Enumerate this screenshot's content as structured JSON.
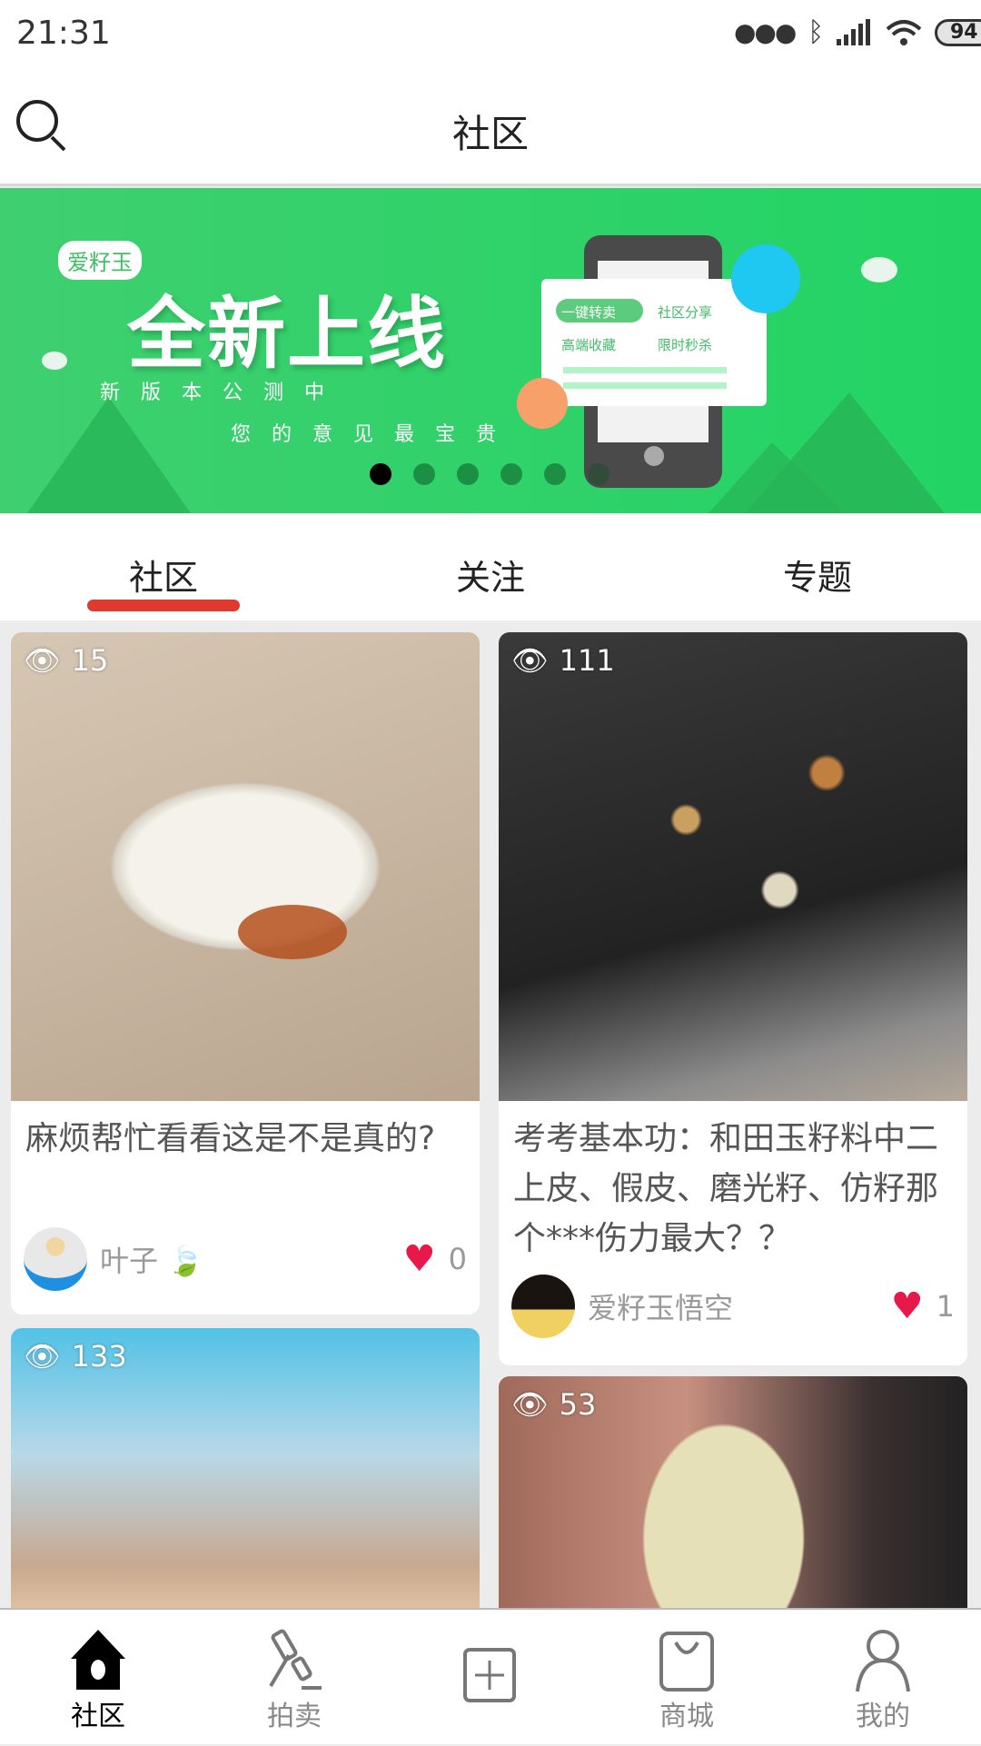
{
  "status": {
    "time": "21:31",
    "battery": "94",
    "icons": [
      "dots-icon",
      "bluetooth-icon",
      "signal-icon",
      "wifi-icon",
      "battery-icon"
    ]
  },
  "header": {
    "title": "社区",
    "search_icon": "search-icon"
  },
  "banner": {
    "badge": "爱籽玉",
    "headline": "全新上线",
    "line1": "新 版 本 公 测 中",
    "line2": "您 的 意 见 最 宝 贵",
    "features": [
      "一键转卖",
      "社区分享",
      "高端收藏",
      "限时秒杀"
    ],
    "dots": 6,
    "active_dot": 0
  },
  "tabs": {
    "items": [
      "社区",
      "关注",
      "专题"
    ],
    "active": 0,
    "accent": "#e03a2e"
  },
  "posts": [
    {
      "views": "15",
      "title": "麻烦帮忙看看这是不是真的?",
      "author": "叶子",
      "likes": "0"
    },
    {
      "views": "111",
      "title": "考考基本功：和田玉籽料中二上皮、假皮、磨光籽、仿籽那个***伤力最大？？",
      "author": "爱籽玉悟空",
      "likes": "1"
    },
    {
      "views": "133"
    },
    {
      "views": "53"
    }
  ],
  "nav": {
    "items": [
      {
        "label": "社区",
        "icon": "home-icon",
        "active": true
      },
      {
        "label": "拍卖",
        "icon": "gavel-icon"
      },
      {
        "label": "",
        "icon": "add-icon"
      },
      {
        "label": "商城",
        "icon": "bag-icon"
      },
      {
        "label": "我的",
        "icon": "user-icon"
      }
    ]
  },
  "colors": {
    "like": "#e8194a",
    "banner_green": "#2fd26a"
  }
}
